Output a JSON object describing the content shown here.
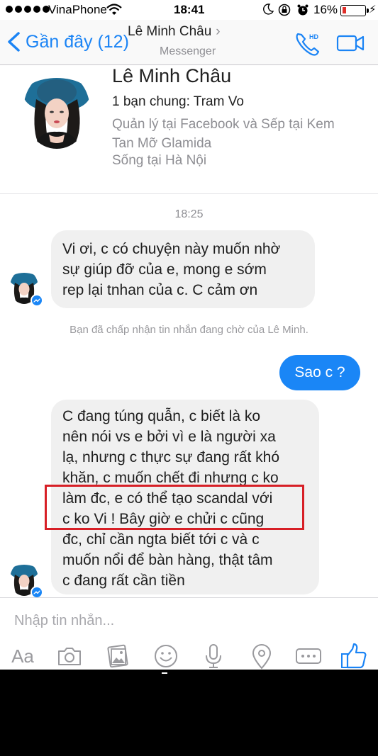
{
  "status_bar": {
    "carrier": "VinaPhone",
    "time": "18:41",
    "battery": "16%"
  },
  "nav": {
    "back_label": "Gần đây (12)",
    "title": "Lê Minh Châu",
    "subtitle": "Messenger",
    "phone_badge": "HD",
    "accent_color": "#1b84f5"
  },
  "profile": {
    "name": "Lê Minh Châu",
    "mutual_friends": "1 bạn chung: Tram Vo",
    "work_lines": [
      "Quản lý tại Facebook và Sếp tại Kem",
      "Tan Mỡ Glamida"
    ],
    "lives": "Sống tại Hà Nội"
  },
  "conversation": {
    "timestamp": "18:25",
    "messages": [
      {
        "direction": "incoming",
        "lines": [
          "Vi ơi, c có chuyện này muốn nhờ",
          "sự giúp đỡ của e, mong e sớm",
          "rep lại tnhan của c. C cảm ơn"
        ]
      },
      {
        "direction": "outgoing",
        "text": "Sao c ?"
      },
      {
        "direction": "incoming",
        "lines": [
          "C đang túng quẫn, c biết là ko",
          "nên nói vs e bởi vì e là người xa",
          "lạ, nhưng c thực sự đang rất khó",
          "khăn, c muốn chết đi nhưng c ko",
          "làm đc, e có thể tạo scandal với",
          "c ko Vi ! Bây giờ e chửi c cũng",
          "đc, chỉ cần ngta biết tới c và c",
          "muốn nổi để bàn hàng, thật tâm",
          "c đang rất cần tiền"
        ]
      }
    ],
    "system_note": "Bạn đã chấp nhận tin nhắn đang chờ của Lê Minh.",
    "highlight_color": "#d71f26"
  },
  "composer": {
    "placeholder": "Nhập tin nhắn...",
    "text_button": "Aa",
    "tools": [
      "camera-icon",
      "photo-icon",
      "emoji-icon",
      "microphone-icon",
      "location-icon",
      "more-icon",
      "like-icon"
    ]
  }
}
